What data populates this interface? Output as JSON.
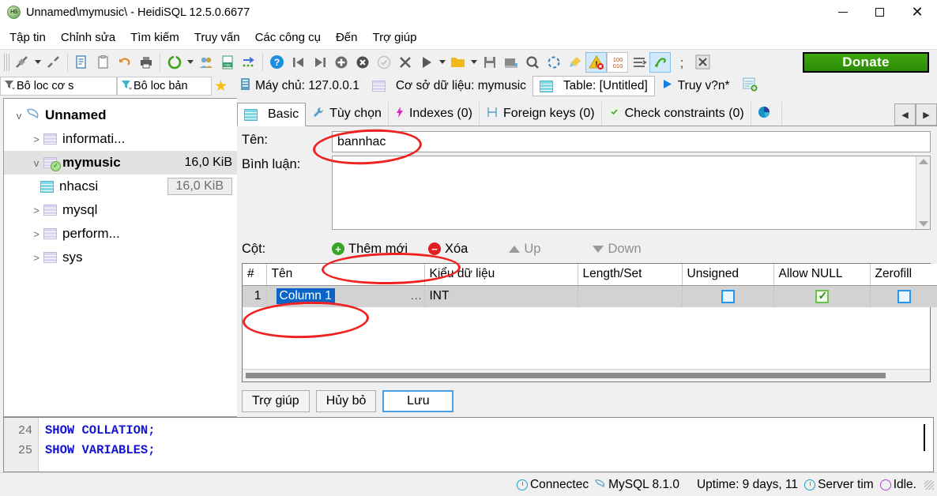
{
  "window": {
    "title": "Unnamed\\mymusic\\ - HeidiSQL 12.5.0.6677",
    "app_icon": "heidisql-logo-icon",
    "minimize": "−",
    "maximize": "□",
    "close": "✕"
  },
  "menu": {
    "items": [
      {
        "label": "Tập tin"
      },
      {
        "label": "Chỉnh sửa"
      },
      {
        "label": "Tìm kiếm"
      },
      {
        "label": "Truy vấn"
      },
      {
        "label": "Các công cụ"
      },
      {
        "label": "Đến"
      },
      {
        "label": "Trợ giúp"
      }
    ]
  },
  "toolbar": {
    "donate_label": "Donate",
    "icons": [
      "connect-plug-icon",
      "connect-dropdown-caret",
      "disconnect-plug-icon",
      "copy-page-icon",
      "paste-clipboard-icon",
      "undo-arrow-icon",
      "print-icon",
      "refresh-icon",
      "refresh-dropdown-caret",
      "users-icon",
      "csv-export-icon",
      "import-arrow-icon",
      "help-question-icon",
      "first-record-icon",
      "last-record-icon",
      "add-record-icon",
      "delete-record-icon",
      "apply-check-icon",
      "cancel-x-icon",
      "run-play-icon",
      "run-dropdown-caret",
      "open-folder-icon",
      "folder-dropdown-caret",
      "save-floppy-icon",
      "save-as-icon",
      "find-magnifier-icon",
      "replace-icon",
      "clean-brush-icon",
      "warning-stop-icon",
      "binary-100-010-icon",
      "wrap-lines-icon",
      "format-sql-icon",
      "semicolon-icon",
      "close-tab-x-icon"
    ]
  },
  "filterbar": {
    "database_filter": "Bô loc cơ s",
    "table_filter": "Bô loc bản",
    "favorite_icon": "star-icon"
  },
  "breadcrumbs": [
    {
      "label": "Máy chủ: 127.0.0.1",
      "icon": "server-icon",
      "selected": false
    },
    {
      "label": "Cơ sở dữ liệu: mymusic",
      "icon": "database-icon",
      "selected": false
    },
    {
      "label": "Table: [Untitled]",
      "icon": "table-icon",
      "selected": true
    },
    {
      "label": "Truy v?n*",
      "icon": "play-icon",
      "selected": false
    },
    {
      "label": "",
      "icon": "new-query-tab-icon",
      "selected": false
    }
  ],
  "sidebar": {
    "nodes": [
      {
        "label": "Unnamed",
        "size": "",
        "level": 0,
        "expander": "v",
        "icon": "dolphin-icon",
        "bold": true,
        "selected": false
      },
      {
        "label": "informati...",
        "size": "",
        "level": 1,
        "expander": ">",
        "icon": "database-icon",
        "bold": false,
        "selected": false
      },
      {
        "label": "mymusic",
        "size": "16,0 KiB",
        "level": 1,
        "expander": "v",
        "icon": "database-icon-active",
        "bold": true,
        "selected": true
      },
      {
        "label": "nhacsi",
        "size": "16,0 KiB",
        "level": 2,
        "expander": "",
        "icon": "table-icon",
        "bold": false,
        "selected": false
      },
      {
        "label": "mysql",
        "size": "",
        "level": 1,
        "expander": ">",
        "icon": "database-icon",
        "bold": false,
        "selected": false
      },
      {
        "label": "perform...",
        "size": "",
        "level": 1,
        "expander": ">",
        "icon": "database-icon",
        "bold": false,
        "selected": false
      },
      {
        "label": "sys",
        "size": "",
        "level": 1,
        "expander": ">",
        "icon": "database-icon",
        "bold": false,
        "selected": false
      }
    ]
  },
  "tabs": [
    {
      "label": "Basic",
      "icon": "table-grid-icon",
      "active": true
    },
    {
      "label": "Tùy chọn",
      "icon": "wrench-icon",
      "active": false
    },
    {
      "label": "Indexes (0)",
      "icon": "lightning-icon",
      "active": false
    },
    {
      "label": "Foreign keys (0)",
      "icon": "foreign-key-icon",
      "active": false
    },
    {
      "label": "Check constraints (0)",
      "icon": "check-circle-icon",
      "active": false
    },
    {
      "label": "",
      "icon": "pie-chart-icon",
      "active": false
    }
  ],
  "tab_scroll": {
    "left": "◀",
    "right": "▶"
  },
  "form": {
    "name_label": "Tên:",
    "name_value": "bannhac",
    "comment_label": "Bình luận:",
    "comment_value": ""
  },
  "columns_toolbar": {
    "label": "Cột:",
    "add_label": "Thêm mới",
    "delete_label": "Xóa",
    "up_label": "Up",
    "down_label": "Down"
  },
  "grid": {
    "headers": [
      "#",
      "Tên",
      "Kiểu dữ liệu",
      "Length/Set",
      "Unsigned",
      "Allow NULL",
      "Zerofill"
    ],
    "rows": [
      {
        "num": "1",
        "name": "Column 1",
        "name_selected": true,
        "ellipsis": "...",
        "datatype": "INT",
        "length": "",
        "unsigned": false,
        "allow_null": true,
        "zerofill": false
      }
    ]
  },
  "dialog_buttons": {
    "help": "Trợ giúp",
    "cancel": "Hủy bỏ",
    "save": "Lưu"
  },
  "sql_log": {
    "lines": [
      {
        "num": "24",
        "text": "SHOW COLLATION;"
      },
      {
        "num": "25",
        "text": "SHOW VARIABLES;"
      }
    ]
  },
  "statusbar": {
    "connected": "Connectec",
    "server": "MySQL 8.1.0",
    "uptime": "Uptime: 9 days, 11",
    "server_time": "Server tim",
    "idle": "Idle."
  },
  "colors": {
    "accent_blue": "#0a64c8",
    "donate_green": "#35a20d",
    "annotation_red": "#ef2222",
    "selected_row": "#d2d2d2"
  }
}
